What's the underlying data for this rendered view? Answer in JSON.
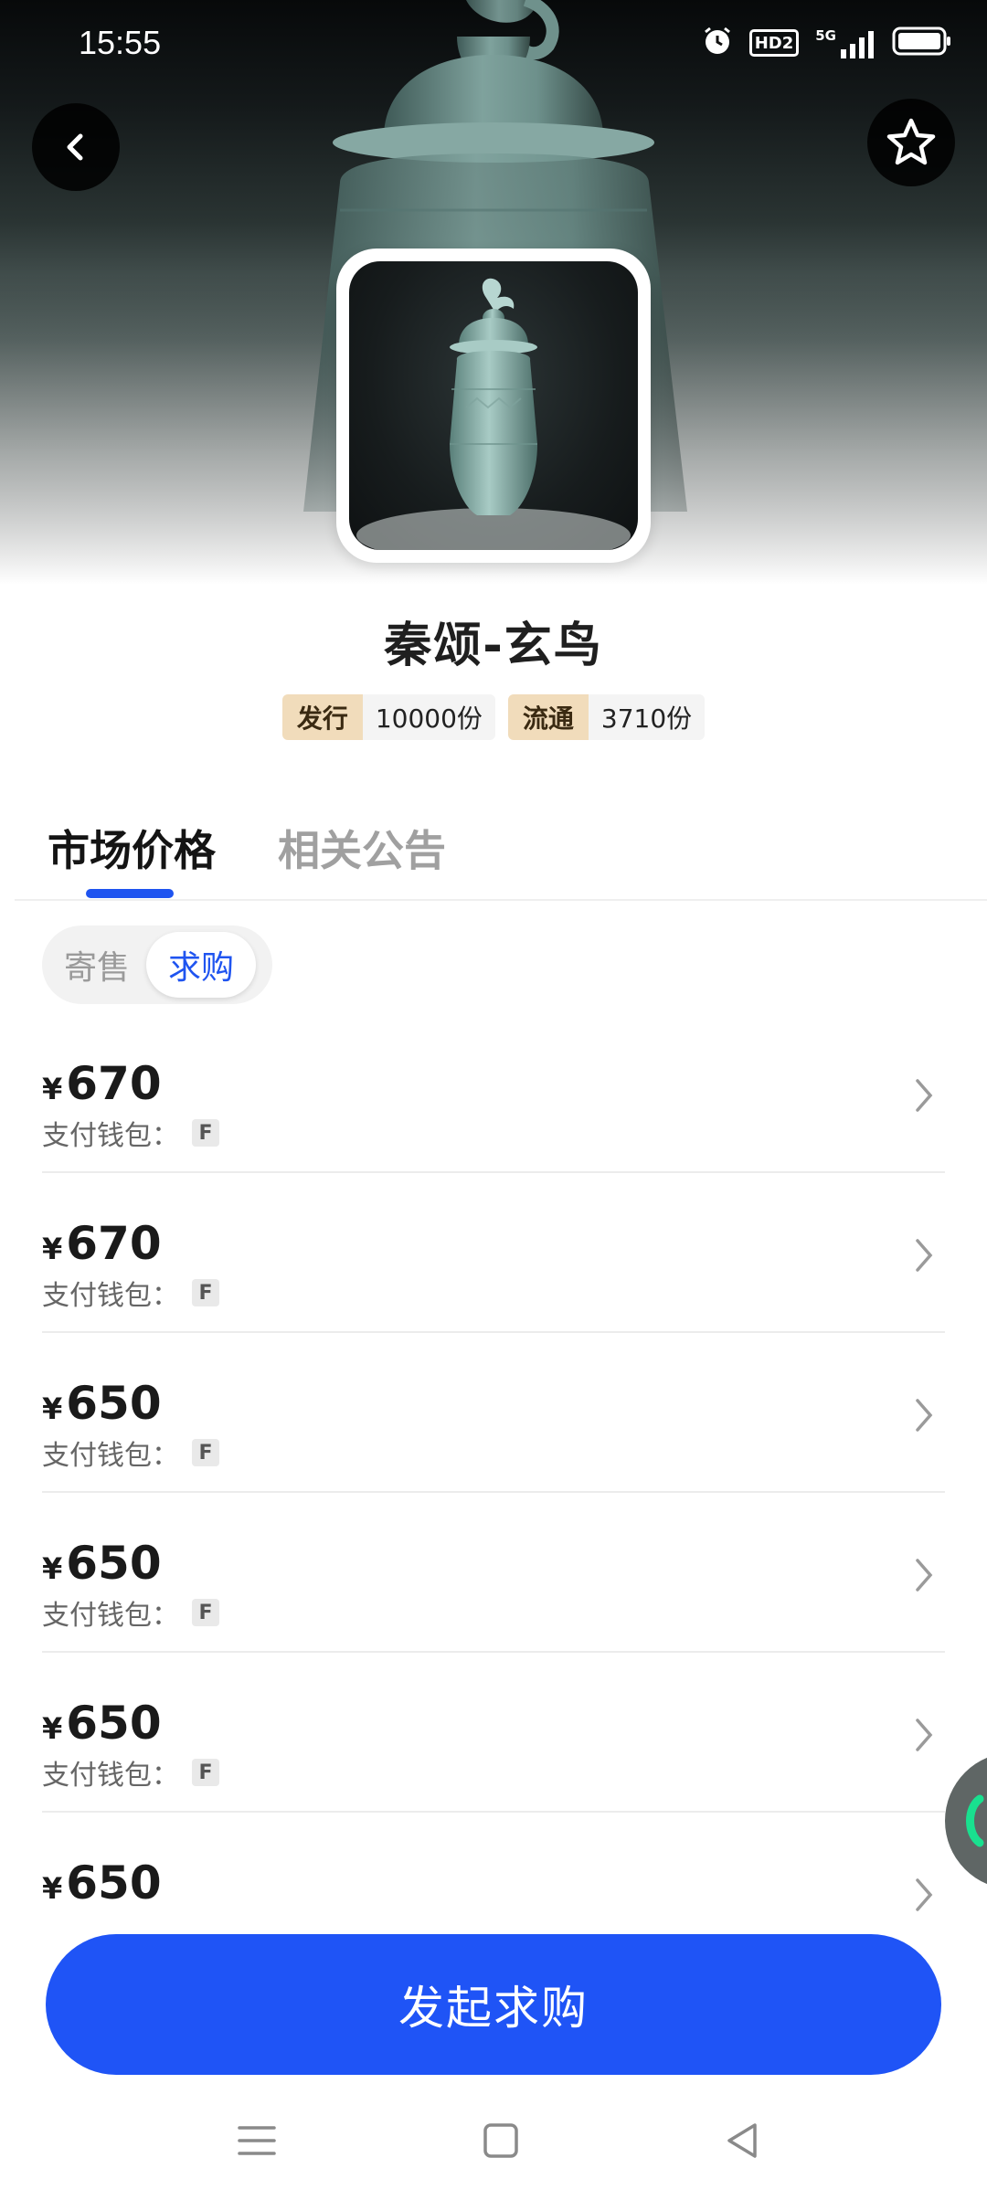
{
  "status_bar": {
    "time": "15:55",
    "icons": [
      "alarm-icon",
      "hd-icon",
      "5g-signal-icon",
      "battery-icon"
    ],
    "hd_label": "HD2",
    "network_label": "5G"
  },
  "header": {
    "back_icon": "chevron-left-icon",
    "favorite_icon": "star-outline-icon"
  },
  "product": {
    "title": "秦颂-玄鸟",
    "badges": [
      {
        "key": "发行",
        "value": "10000份"
      },
      {
        "key": "流通",
        "value": "3710份"
      }
    ]
  },
  "tabs": [
    {
      "label": "市场价格",
      "active": true
    },
    {
      "label": "相关公告",
      "active": false
    }
  ],
  "segment": {
    "items": [
      {
        "label": "寄售",
        "active": false
      },
      {
        "label": "求购",
        "active": true
      }
    ]
  },
  "listings": [
    {
      "currency": "¥",
      "price": "670",
      "wallet_label": "支付钱包：",
      "wallet_tag": "F"
    },
    {
      "currency": "¥",
      "price": "670",
      "wallet_label": "支付钱包：",
      "wallet_tag": "F"
    },
    {
      "currency": "¥",
      "price": "650",
      "wallet_label": "支付钱包：",
      "wallet_tag": "F"
    },
    {
      "currency": "¥",
      "price": "650",
      "wallet_label": "支付钱包：",
      "wallet_tag": "F"
    },
    {
      "currency": "¥",
      "price": "650",
      "wallet_label": "支付钱包：",
      "wallet_tag": "F"
    },
    {
      "currency": "¥",
      "price": "650",
      "wallet_label": "",
      "wallet_tag": ""
    }
  ],
  "cta": {
    "label": "发起求购"
  },
  "colors": {
    "accent": "#1f54f6",
    "badge_key_bg": "#f1dcbb",
    "segment_active": "#1f54f0"
  },
  "navbar": {
    "icons": [
      "menu-icon",
      "home-square-icon",
      "back-triangle-icon"
    ]
  }
}
